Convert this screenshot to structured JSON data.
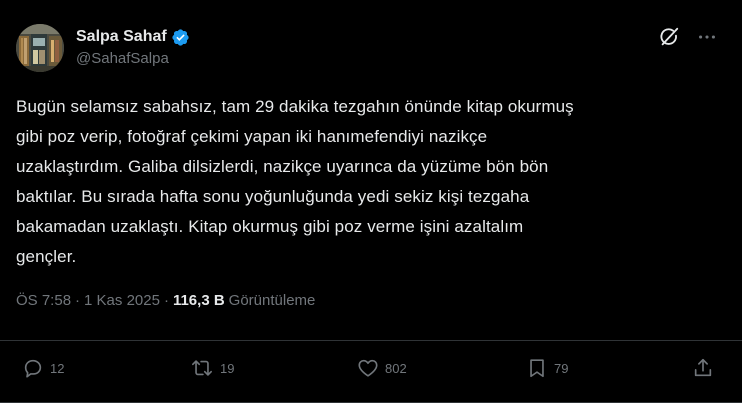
{
  "author": {
    "display_name": "Salpa Sahaf",
    "handle": "@SahafSalpa",
    "verified": true
  },
  "tweet": {
    "text": "Bugün selamsız sabahsız, tam 29 dakika tezgahın önünde kitap okurmuş\ngibi poz verip, fotoğraf çekimi yapan iki hanımefendiyi nazikçe\nuzaklaştırdım. Galiba dilsizlerdi, nazikçe uyarınca da yüzüme bön bön\nbaktılar. Bu sırada hafta sonu yoğunluğunda yedi sekiz kişi tezgaha\nbakamadan uzaklaştı. Kitap okurmuş gibi poz verme işini azaltalım\ngençler.",
    "time": "ÖS 7:58",
    "date": "1 Kas 2025",
    "separator": "·",
    "views_count": "116,3 B",
    "views_label": "Görüntüleme"
  },
  "actions": {
    "replies": "12",
    "reposts": "19",
    "likes": "802",
    "bookmarks": "79"
  },
  "icons": {
    "verified": "verified-badge-icon",
    "grok": "grok-icon",
    "more": "more-dots-icon",
    "reply": "reply-icon",
    "repost": "repost-icon",
    "like": "heart-icon",
    "bookmark": "bookmark-icon",
    "share": "share-icon"
  },
  "colors": {
    "background": "#000000",
    "text": "#e7e9ea",
    "muted": "#71767b",
    "verified": "#1d9bf0",
    "divider": "#2f3336"
  }
}
